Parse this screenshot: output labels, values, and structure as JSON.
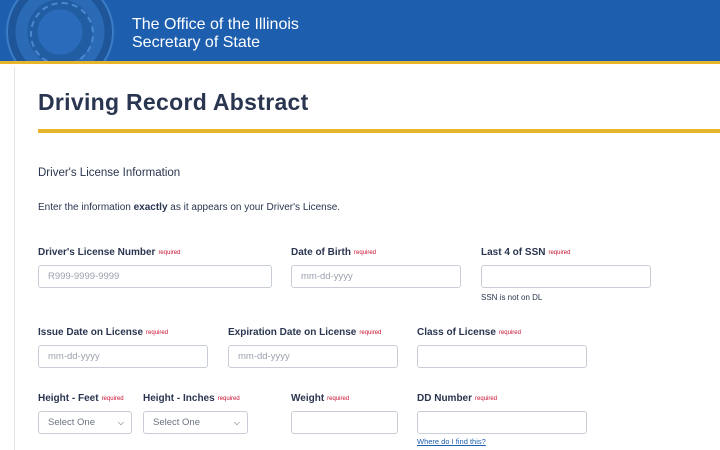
{
  "header": {
    "agency_line1": "The Office of the Illinois",
    "agency_line2": "Secretary of State",
    "brand_color": "#1d5fae",
    "accent_color": "#e7b52c"
  },
  "page": {
    "title": "Driving Record Abstract",
    "section_title": "Driver's License Information",
    "intro_before": "Enter the information ",
    "intro_bold": "exactly",
    "intro_after": " as it appears on your Driver's License."
  },
  "required_text": "required",
  "fields": {
    "license_number": {
      "label": "Driver's License Number",
      "placeholder": "R999-9999-9999",
      "value": ""
    },
    "dob": {
      "label": "Date of Birth",
      "placeholder": "mm-dd-yyyy",
      "value": ""
    },
    "ssn4": {
      "label": "Last 4 of SSN",
      "placeholder": "",
      "value": "",
      "help": "SSN is not on DL"
    },
    "issue_date": {
      "label": "Issue Date on License",
      "placeholder": "mm-dd-yyyy",
      "value": ""
    },
    "expiration_date": {
      "label": "Expiration Date on License",
      "placeholder": "mm-dd-yyyy",
      "value": ""
    },
    "license_class": {
      "label": "Class of License",
      "placeholder": "",
      "value": ""
    },
    "height_feet": {
      "label": "Height - Feet",
      "selected": "Select One"
    },
    "height_inches": {
      "label": "Height - Inches",
      "selected": "Select One"
    },
    "weight": {
      "label": "Weight",
      "placeholder": "",
      "value": ""
    },
    "dd_number": {
      "label": "DD Number",
      "placeholder": "",
      "value": "",
      "help_link": "Where do I find this?"
    }
  }
}
